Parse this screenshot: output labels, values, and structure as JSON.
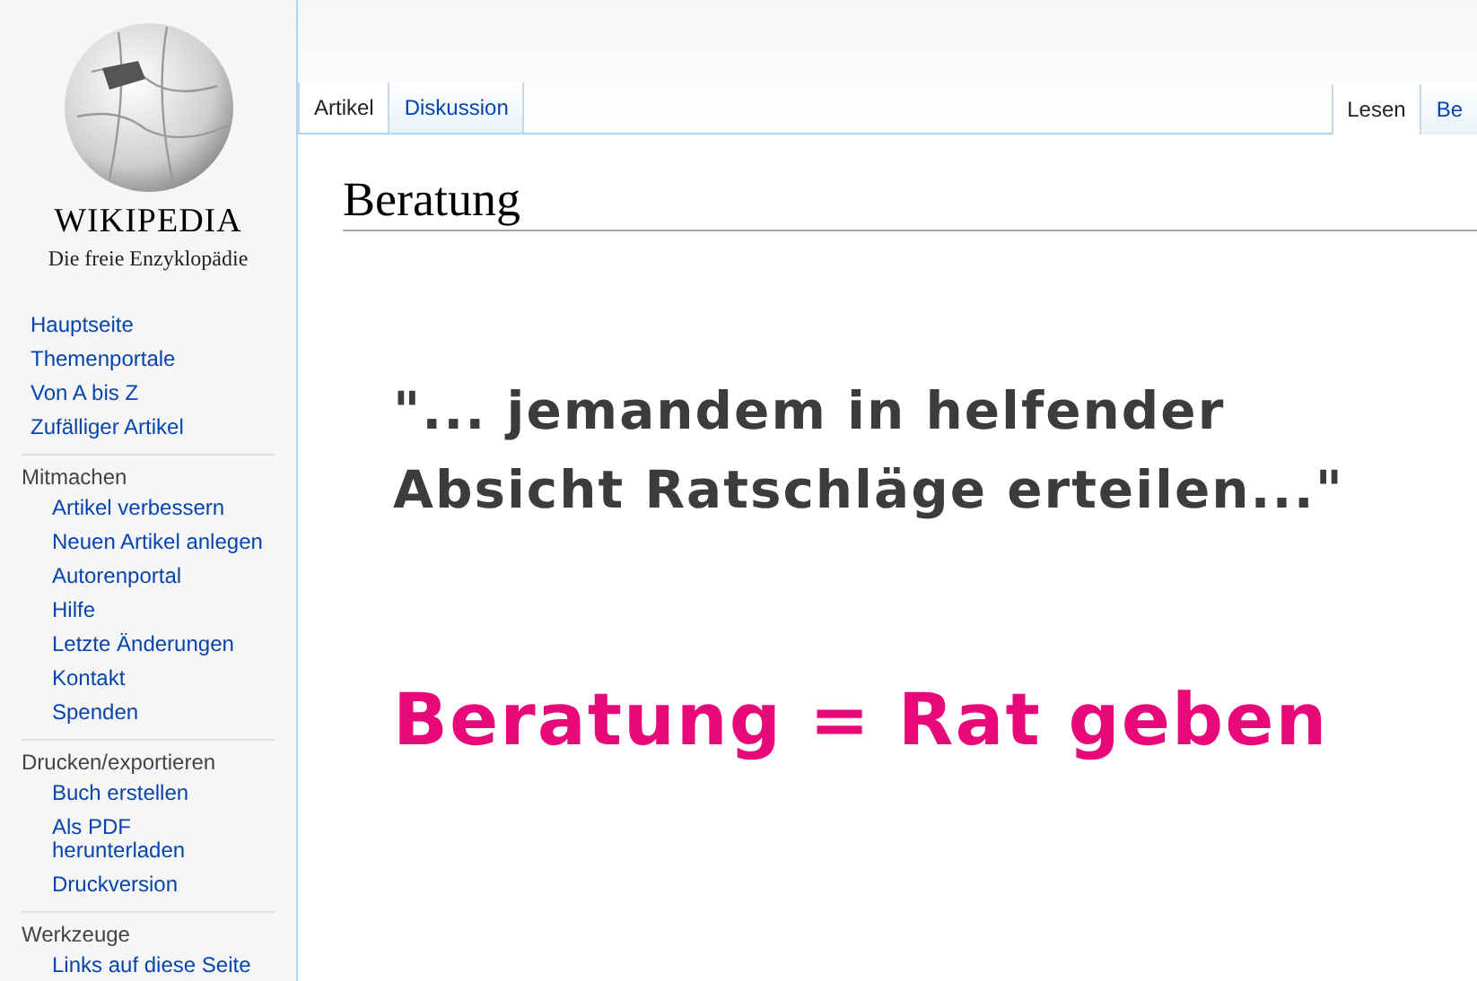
{
  "logo": {
    "wordmark": "WIKIPEDIA",
    "tagline": "Die freie Enzyklopädie"
  },
  "sidebar": {
    "items": [
      {
        "label": "Hauptseite"
      },
      {
        "label": "Themenportale"
      },
      {
        "label": "Von A bis Z"
      },
      {
        "label": "Zufälliger Artikel"
      }
    ],
    "sections": [
      {
        "heading": "Mitmachen",
        "items": [
          "Artikel verbessern",
          "Neuen Artikel anlegen",
          "Autorenportal",
          "Hilfe",
          "Letzte Änderungen",
          "Kontakt",
          "Spenden"
        ]
      },
      {
        "heading": "Drucken/exportieren",
        "items": [
          "Buch erstellen",
          "Als PDF herunterladen",
          "Druckversion"
        ]
      },
      {
        "heading": "Werkzeuge",
        "items": [
          "Links auf diese Seite"
        ]
      }
    ]
  },
  "left_tabs": [
    {
      "label": "Artikel",
      "selected": true
    },
    {
      "label": "Diskussion",
      "selected": false
    }
  ],
  "right_tabs": [
    {
      "label": "Lesen",
      "selected": true
    },
    {
      "label": "Be",
      "selected": false
    }
  ],
  "page_title": "Beratung",
  "quote_lines": [
    "\"... jemandem in helfender",
    "Absicht Ratschläge erteilen...\""
  ],
  "slogan": "Beratung = Rat geben"
}
